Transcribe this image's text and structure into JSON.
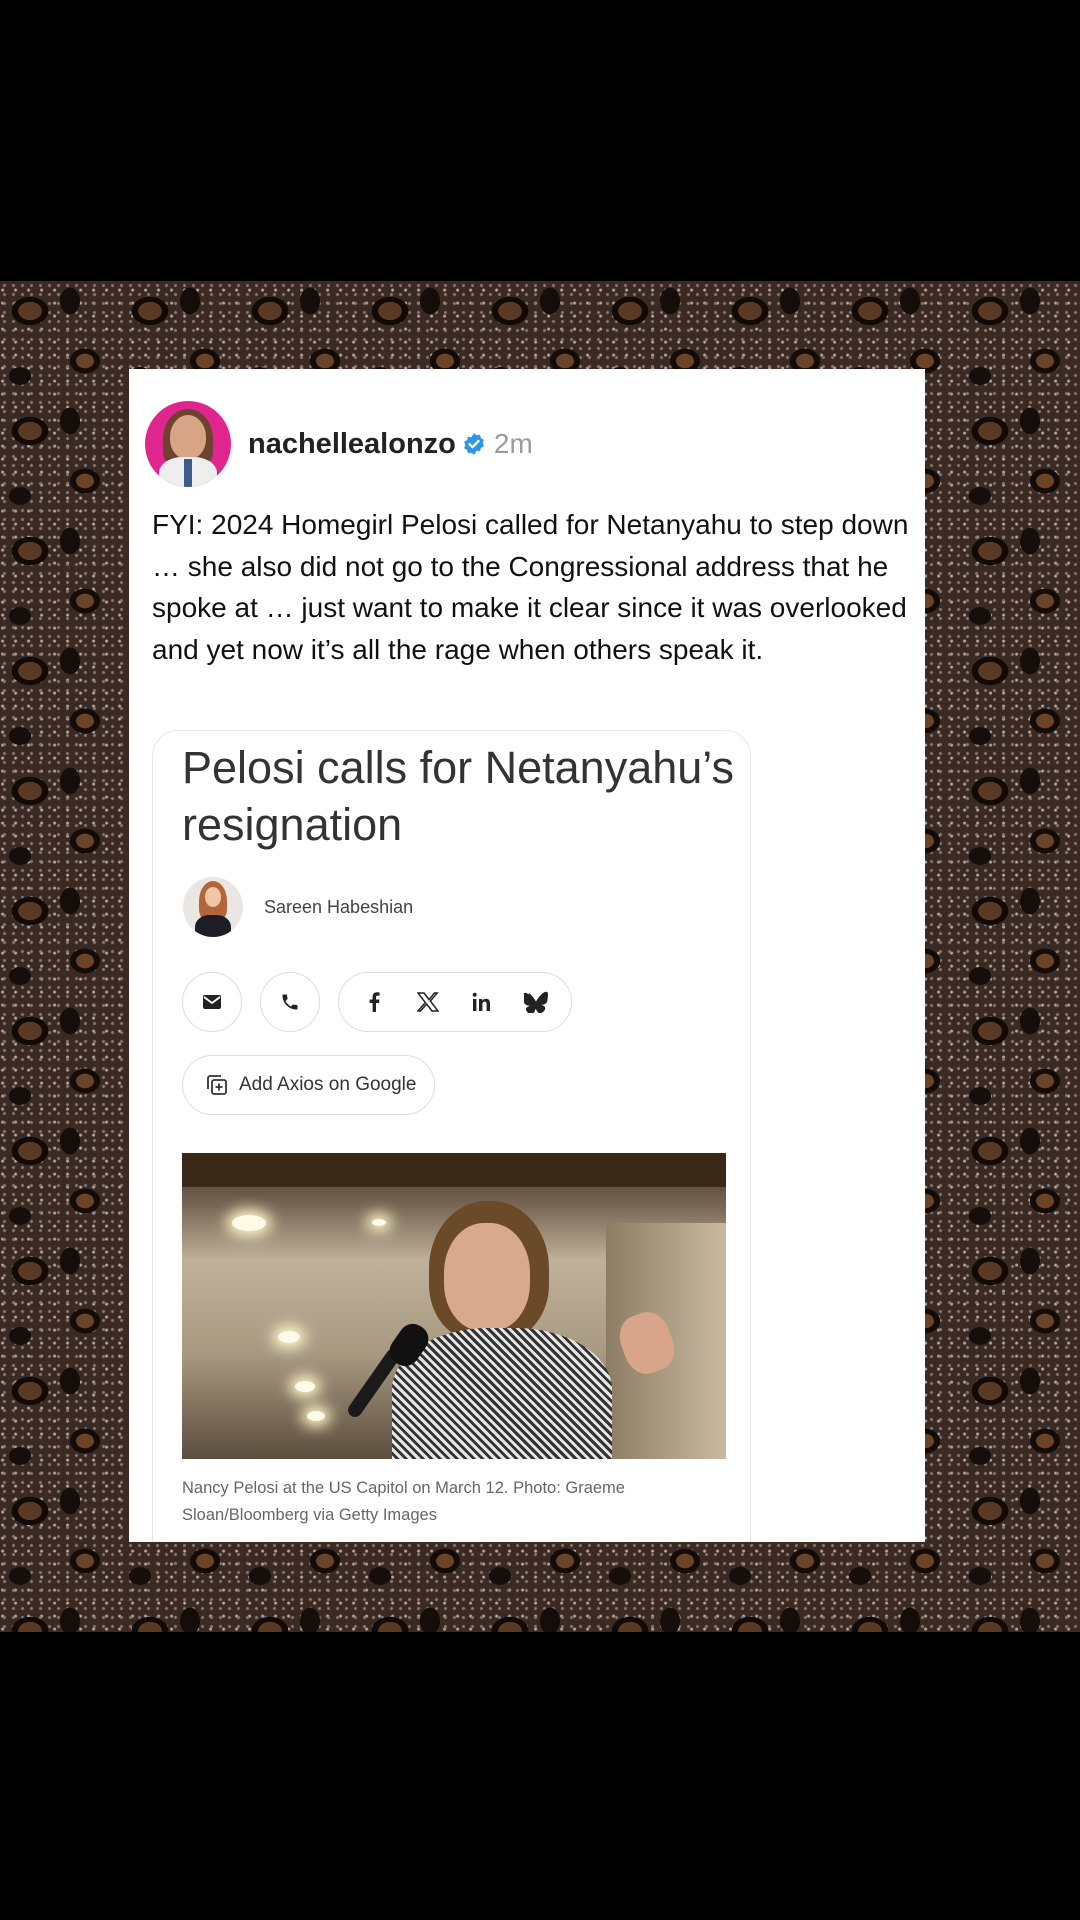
{
  "post": {
    "username": "nachellealonzo",
    "time": "2m",
    "text": "FYI: 2024 Homegirl Pelosi called for Netanyahu to step down … she also did not go to the Congressional address that he spoke at … just want to make it clear since it was overlooked and yet now it’s all the rage when others speak it."
  },
  "article": {
    "headline": "Pelosi calls for Netanyahu’s resignation",
    "author": "Sareen Habeshian",
    "add_google_label": "Add Axios on Google",
    "caption": "Nancy Pelosi at the US Capitol on March 12. Photo: Graeme Sloan/Bloomberg via Getty Images"
  },
  "icons": {
    "share": [
      "mail-icon",
      "phone-icon",
      "facebook-icon",
      "x-icon",
      "linkedin-icon",
      "bluesky-icon"
    ]
  },
  "colors": {
    "verified": "#2f95e8",
    "avatar_bg": "#e0258f",
    "background_pattern": "leopard"
  }
}
